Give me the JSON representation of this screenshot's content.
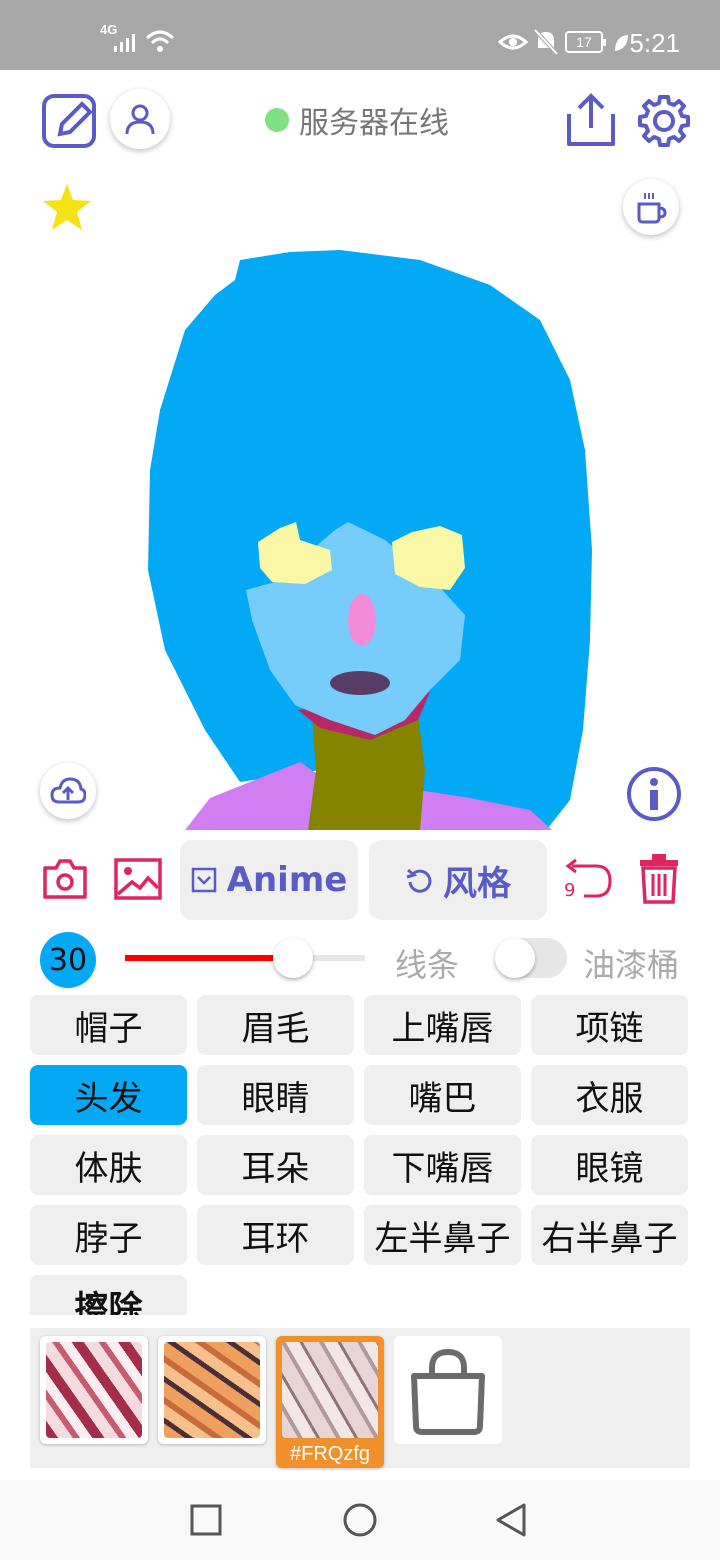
{
  "status_bar": {
    "network": "4G",
    "battery": "17",
    "time": "5:21"
  },
  "header": {
    "server_status": "服务器在线"
  },
  "toolbar": {
    "model_label": "Anime",
    "style_label": "风格",
    "undo_count": "9"
  },
  "brush": {
    "size": "30",
    "size_fraction": 0.7,
    "line_label": "线条",
    "bucket_label": "油漆桶",
    "bucket_enabled": false
  },
  "parts": [
    {
      "label": "帽子"
    },
    {
      "label": "眉毛"
    },
    {
      "label": "上嘴唇"
    },
    {
      "label": "项链"
    },
    {
      "label": "头发"
    },
    {
      "label": "眼睛"
    },
    {
      "label": "嘴巴"
    },
    {
      "label": "衣服"
    },
    {
      "label": "体肤"
    },
    {
      "label": "耳朵"
    },
    {
      "label": "下嘴唇"
    },
    {
      "label": "眼镜"
    },
    {
      "label": "脖子"
    },
    {
      "label": "耳环"
    },
    {
      "label": "左半鼻子"
    },
    {
      "label": "右半鼻子"
    },
    {
      "label": "擦除"
    }
  ],
  "selected_part": "头发",
  "styles": {
    "selected_tag": "#FRQzfg"
  },
  "colors": {
    "accent": "#5b5bc8",
    "selected": "#03a9f4",
    "danger": "#e0245e",
    "server_online": "#7ee081",
    "style_selected": "#f2912c"
  }
}
